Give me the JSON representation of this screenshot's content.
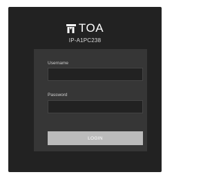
{
  "header": {
    "logo_text": "TOA",
    "device_name": "IP-A1PC238"
  },
  "login_form": {
    "username_label": "Username",
    "username_value": "",
    "password_label": "Password",
    "password_value": "",
    "login_label": "LOGIN"
  },
  "colors": {
    "frame_background": "#222222",
    "panel_background": "#363636",
    "input_background": "#222222",
    "button_background": "#bbbbbb"
  }
}
